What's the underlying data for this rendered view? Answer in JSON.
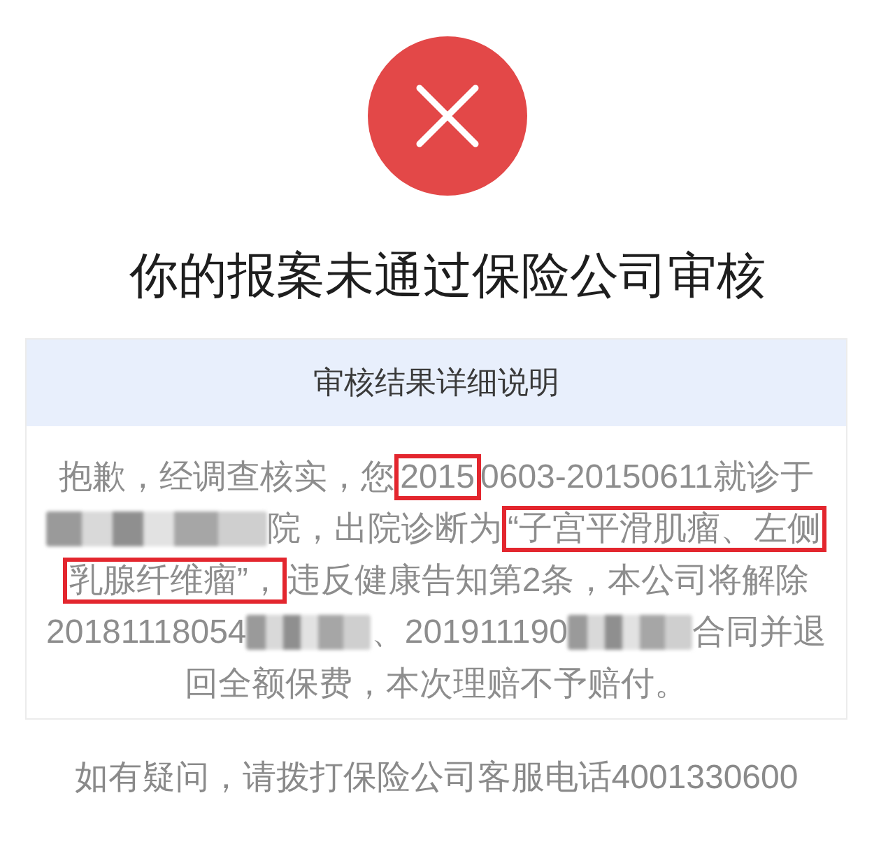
{
  "title": "你的报案未通过保险公司审核",
  "detail": {
    "heading": "审核结果详细说明",
    "lines": [
      {
        "segments": [
          {
            "kind": "text",
            "text": "抱歉，经调查核实，您"
          },
          {
            "kind": "marked",
            "text": "2015"
          },
          {
            "kind": "text",
            "text": "0603-20150611就诊于"
          }
        ]
      },
      {
        "segments": [
          {
            "kind": "redacted"
          },
          {
            "kind": "text",
            "text": "院，出院诊断为"
          },
          {
            "kind": "marked",
            "text": "“子宫平滑肌瘤、左侧"
          }
        ]
      },
      {
        "segments": [
          {
            "kind": "marked",
            "text": "乳腺纤维瘤”，"
          },
          {
            "kind": "text",
            "text": "违反健康告知第2条，本公司将解除"
          }
        ]
      },
      {
        "segments": [
          {
            "kind": "text",
            "text": "20181118054"
          },
          {
            "kind": "redacted"
          },
          {
            "kind": "text",
            "text": "、201911190"
          },
          {
            "kind": "redacted"
          },
          {
            "kind": "text",
            "text": "合同并退"
          }
        ]
      },
      {
        "segments": [
          {
            "kind": "text",
            "text": "回全额保费，本次理赔不予赔付。"
          }
        ]
      }
    ]
  },
  "footer": "如有疑问，请拨打保险公司客服电话4001330600"
}
